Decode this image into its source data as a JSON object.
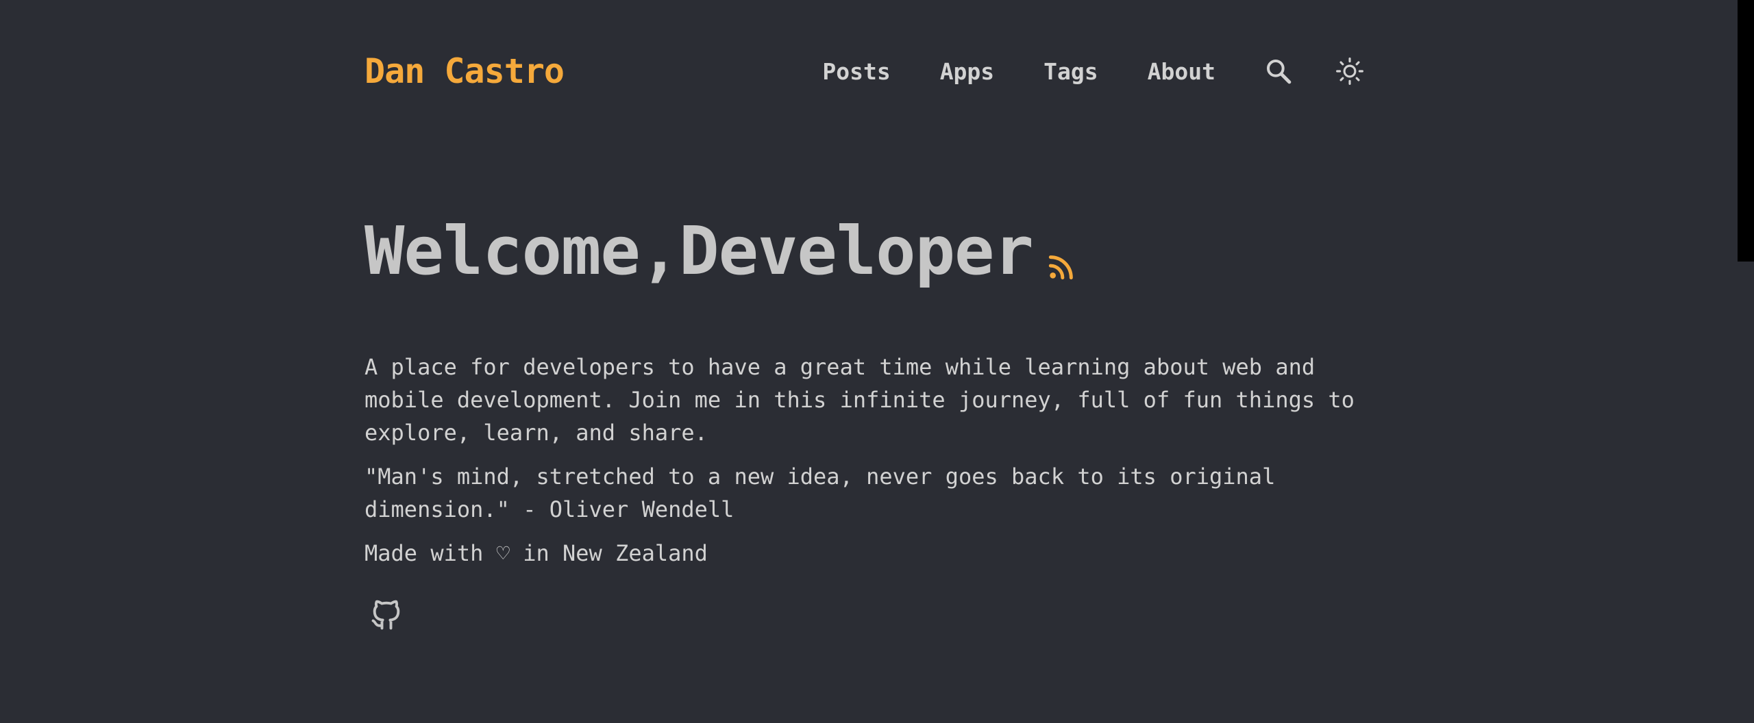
{
  "header": {
    "logo": "Dan Castro",
    "nav": [
      {
        "label": "Posts"
      },
      {
        "label": "Apps"
      },
      {
        "label": "Tags"
      },
      {
        "label": "About"
      }
    ],
    "search_icon": "search-icon",
    "theme_icon": "sun-icon"
  },
  "hero": {
    "title": "Welcome,Developer",
    "rss_icon": "rss-icon"
  },
  "content": {
    "intro": "A place for developers to have a great time while learning about web and mobile development. Join me in this infinite journey, full of fun things to explore, learn, and share.",
    "quote": "\"Man's mind, stretched to a new idea, never goes back to its original dimension.\" - Oliver Wendell",
    "made_with": "Made with ♡ in New Zealand"
  },
  "social": {
    "github_icon": "github-icon"
  },
  "colors": {
    "background": "#2b2d34",
    "accent": "#f5a93b",
    "text": "#d2d2d2",
    "heading": "#c6c6c6"
  }
}
